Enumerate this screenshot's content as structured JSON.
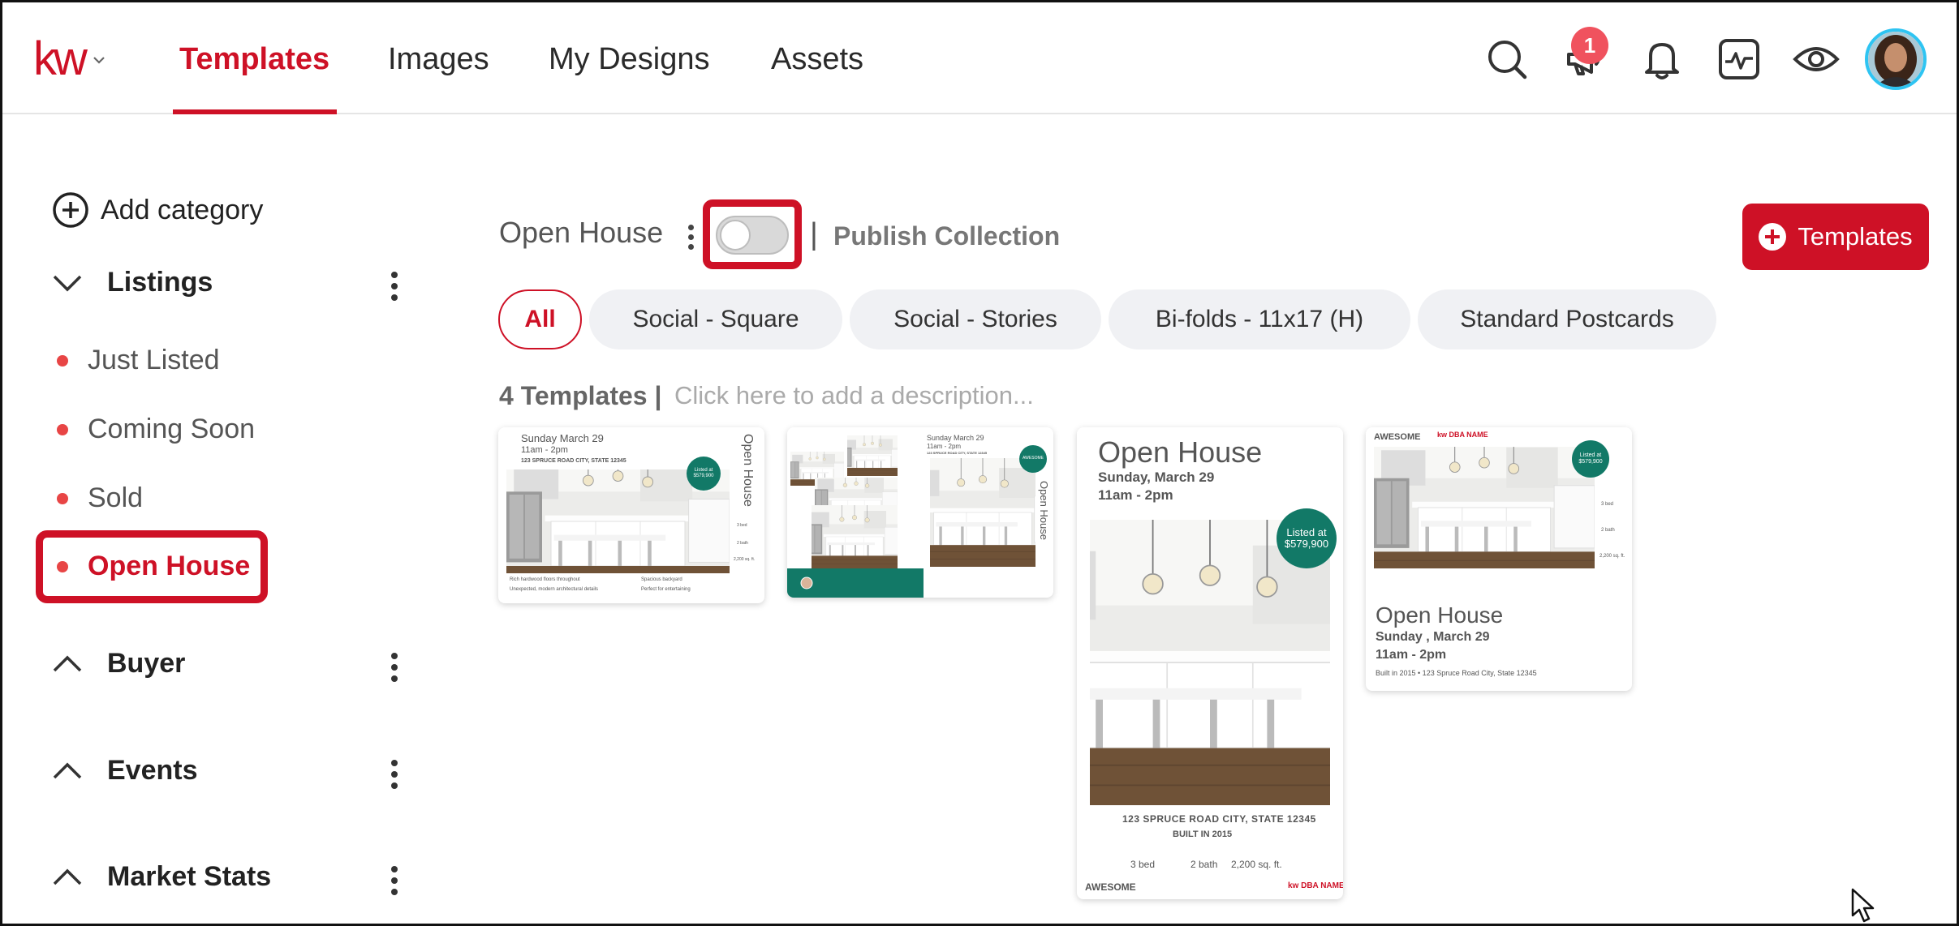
{
  "colors": {
    "brand": "#ce1126",
    "teal": "#127967",
    "badge": "#f0525e",
    "avatar_ring": "#2ec4f2"
  },
  "header": {
    "logo_text": "kw",
    "tabs": [
      {
        "label": "Templates",
        "active": true
      },
      {
        "label": "Images",
        "active": false
      },
      {
        "label": "My Designs",
        "active": false
      },
      {
        "label": "Assets",
        "active": false
      }
    ],
    "icons": [
      "search-icon",
      "megaphone-icon",
      "bell-icon",
      "activity-icon",
      "eye-icon"
    ],
    "notification_count": "1"
  },
  "sidebar": {
    "add_category": "Add category",
    "groups": [
      {
        "label": "Listings",
        "expanded": true,
        "items": [
          {
            "label": "Just Listed",
            "active": false
          },
          {
            "label": "Coming Soon",
            "active": false
          },
          {
            "label": "Sold",
            "active": false
          },
          {
            "label": "Open House",
            "active": true
          }
        ]
      },
      {
        "label": "Buyer",
        "expanded": false
      },
      {
        "label": "Events",
        "expanded": false
      },
      {
        "label": "Market Stats",
        "expanded": false
      }
    ]
  },
  "main": {
    "collection_title": "Open House",
    "publish_separator": "|",
    "publish_label": "Publish Collection",
    "publish_enabled": false,
    "add_templates_label": "Templates",
    "chips": [
      {
        "label": "All",
        "active": true
      },
      {
        "label": "Social - Square",
        "active": false
      },
      {
        "label": "Social - Stories",
        "active": false
      },
      {
        "label": "Bi-folds - 11x17 (H)",
        "active": false
      },
      {
        "label": "Standard Postcards",
        "active": false
      }
    ],
    "template_count": "4 Templates |",
    "description_placeholder": "Click here to add a description..."
  },
  "cards": {
    "c1": {
      "date": "Sunday March 29",
      "time": "11am - 2pm",
      "address": "123 SPRUCE ROAD CITY, STATE 12345",
      "vertical_title": "Open House",
      "badge": "$579,900",
      "badge_prefix": "Listed at",
      "stats": [
        "3 bed",
        "2 bath",
        "2,200 sq. ft."
      ],
      "bullets": [
        "Rich hardwood floors throughout",
        "Spacious backyard",
        "Unexpected, modern architectural details",
        "Perfect for entertaining"
      ]
    },
    "c2": {
      "date": "Sunday March 29",
      "time": "11am - 2pm",
      "address": "123 SPRUCE ROAD CITY, STATE 12345",
      "vertical_title": "Open House",
      "logo": "AWESOME"
    },
    "c3": {
      "title": "Open House",
      "date": "Sunday, March 29",
      "time": "11am - 2pm",
      "badge_prefix": "Listed at",
      "badge": "$579,900",
      "address": "123 SPRUCE ROAD CITY, STATE 12345",
      "built": "BUILT IN 2015",
      "stats": [
        "3 bed",
        "2 bath",
        "2,200 sq. ft."
      ],
      "logo": "AWESOME",
      "brand": "kw DBA NAME"
    },
    "c4": {
      "logo": "AWESOME",
      "brand": "kw DBA NAME",
      "badge_prefix": "Listed at",
      "badge": "$579,900",
      "stats": [
        "3 bed",
        "2 bath",
        "2,200 sq. ft."
      ],
      "title": "Open House",
      "date": "Sunday , March 29",
      "time": "11am - 2pm",
      "footer": "Built in 2015 • 123 Spruce Road City, State 12345"
    }
  }
}
